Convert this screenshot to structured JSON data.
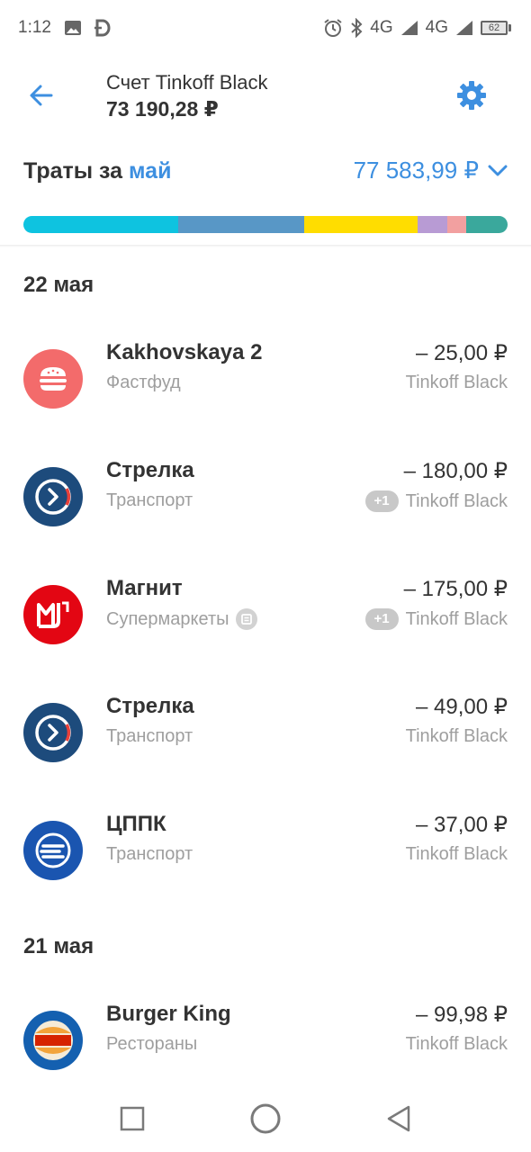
{
  "status_bar": {
    "time": "1:12",
    "network_labels": [
      "4G",
      "4G"
    ],
    "battery": "62",
    "icons": [
      "image-icon",
      "d-app-icon",
      "alarm-icon",
      "bluetooth-icon",
      "signal-icon",
      "battery-icon"
    ]
  },
  "header": {
    "account_name": "Счет Tinkoff Black",
    "balance": "73 190,28 ₽"
  },
  "spending": {
    "label": "Траты за",
    "month": "май",
    "total": "77 583,99 ₽",
    "segments": [
      {
        "category_color": "#0ec3e0",
        "share": 0.32
      },
      {
        "category_color": "#5897c6",
        "share": 0.26
      },
      {
        "category_color": "#ffdd00",
        "share": 0.235
      },
      {
        "category_color": "#b89bd4",
        "share": 0.06
      },
      {
        "category_color": "#f2a0a0",
        "share": 0.04
      },
      {
        "category_color": "#3aa89c",
        "share": 0.085
      }
    ]
  },
  "groups": [
    {
      "date": "22 мая",
      "transactions": [
        {
          "name": "Kakhovskaya 2",
          "category": "Фастфуд",
          "amount": "– 25,00 ₽",
          "card": "Tinkoff Black",
          "badge": "",
          "logo": "burger-icon",
          "logo_color": "#f36b6b"
        },
        {
          "name": "Стрелка",
          "category": "Транспорт",
          "amount": "– 180,00 ₽",
          "card": "Tinkoff Black",
          "badge": "+1",
          "logo": "strelka-icon",
          "logo_color": "#1d4b7c"
        },
        {
          "name": "Магнит",
          "category": "Супермаркеты",
          "amount": "– 175,00 ₽",
          "card": "Tinkoff Black",
          "badge": "+1",
          "logo": "magnit-icon",
          "logo_color": "#e30613"
        },
        {
          "name": "Стрелка",
          "category": "Транспорт",
          "amount": "– 49,00 ₽",
          "card": "Tinkoff Black",
          "badge": "",
          "logo": "strelka-icon",
          "logo_color": "#1d4b7c"
        },
        {
          "name": "ЦППК",
          "category": "Транспорт",
          "amount": "– 37,00 ₽",
          "card": "Tinkoff Black",
          "badge": "",
          "logo": "cppk-icon",
          "logo_color": "#1a55b0"
        }
      ]
    },
    {
      "date": "21 мая",
      "transactions": [
        {
          "name": "Burger King",
          "category": "Рестораны",
          "amount": "– 99,98 ₽",
          "card": "Tinkoff Black",
          "badge": "",
          "logo": "burger-king-icon",
          "logo_color": "#1460b0"
        }
      ]
    }
  ],
  "nav": {
    "icons": [
      "recent-apps-icon",
      "home-icon",
      "back-nav-icon"
    ]
  }
}
